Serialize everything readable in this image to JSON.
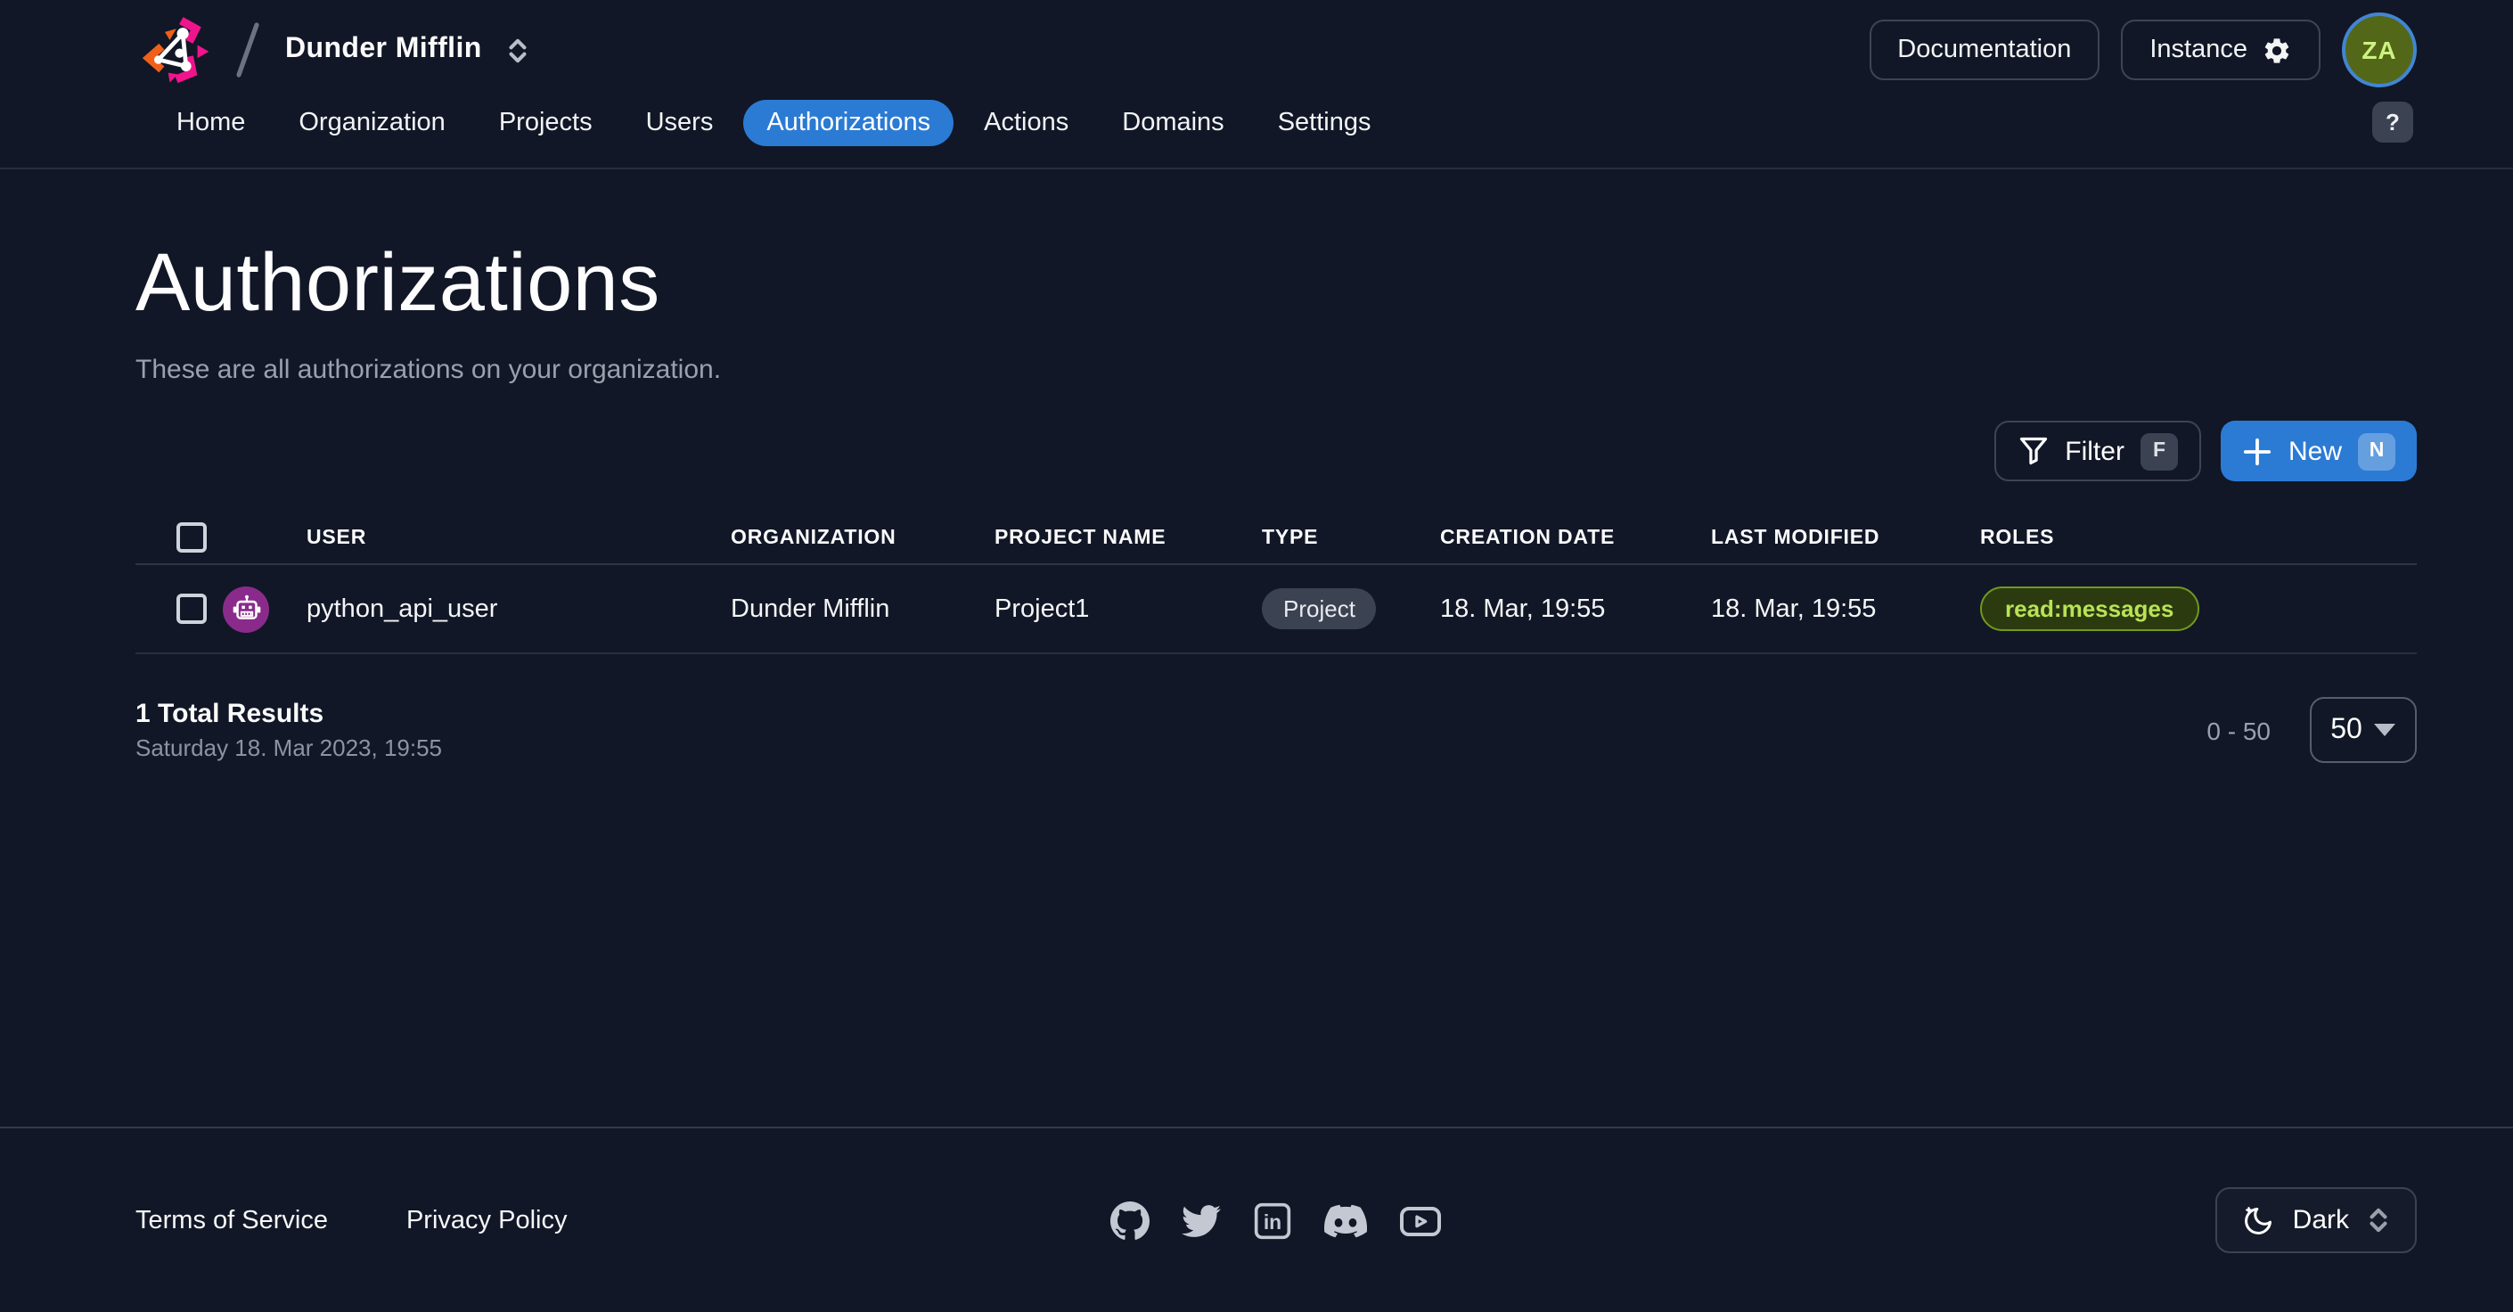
{
  "topbar": {
    "org_name": "Dunder Mifflin",
    "documentation_label": "Documentation",
    "instance_label": "Instance",
    "avatar_initials": "ZA"
  },
  "nav": {
    "tabs": [
      {
        "label": "Home",
        "active": false
      },
      {
        "label": "Organization",
        "active": false
      },
      {
        "label": "Projects",
        "active": false
      },
      {
        "label": "Users",
        "active": false
      },
      {
        "label": "Authorizations",
        "active": true
      },
      {
        "label": "Actions",
        "active": false
      },
      {
        "label": "Domains",
        "active": false
      },
      {
        "label": "Settings",
        "active": false
      }
    ],
    "help_label": "?"
  },
  "page": {
    "title": "Authorizations",
    "subtitle": "These are all authorizations on your organization."
  },
  "actions": {
    "filter_label": "Filter",
    "filter_shortcut": "F",
    "new_label": "New",
    "new_shortcut": "N"
  },
  "table": {
    "columns": [
      "USER",
      "ORGANIZATION",
      "PROJECT NAME",
      "TYPE",
      "CREATION DATE",
      "LAST MODIFIED",
      "ROLES"
    ],
    "rows": [
      {
        "user": "python_api_user",
        "organization": "Dunder Mifflin",
        "project_name": "Project1",
        "type": "Project",
        "creation_date": "18. Mar, 19:55",
        "last_modified": "18. Mar, 19:55",
        "roles": [
          "read:messages"
        ]
      }
    ]
  },
  "summary": {
    "total_label": "1 Total Results",
    "timestamp": "Saturday 18. Mar 2023, 19:55",
    "range": "0 - 50",
    "page_size": "50"
  },
  "footer": {
    "links": [
      "Terms of Service",
      "Privacy Policy"
    ],
    "social": [
      "github-icon",
      "twitter-icon",
      "linkedin-icon",
      "discord-icon",
      "youtube-icon"
    ],
    "theme_label": "Dark"
  },
  "colors": {
    "background": "#111726",
    "accent_blue": "#2b7bd4",
    "row_avatar_purple": "#8a2b8c",
    "role_badge_text": "#b8e356",
    "role_badge_border": "#71991f",
    "za_avatar_fill": "#536719",
    "za_avatar_text": "#cdf282",
    "za_avatar_ring": "#4285d2"
  }
}
